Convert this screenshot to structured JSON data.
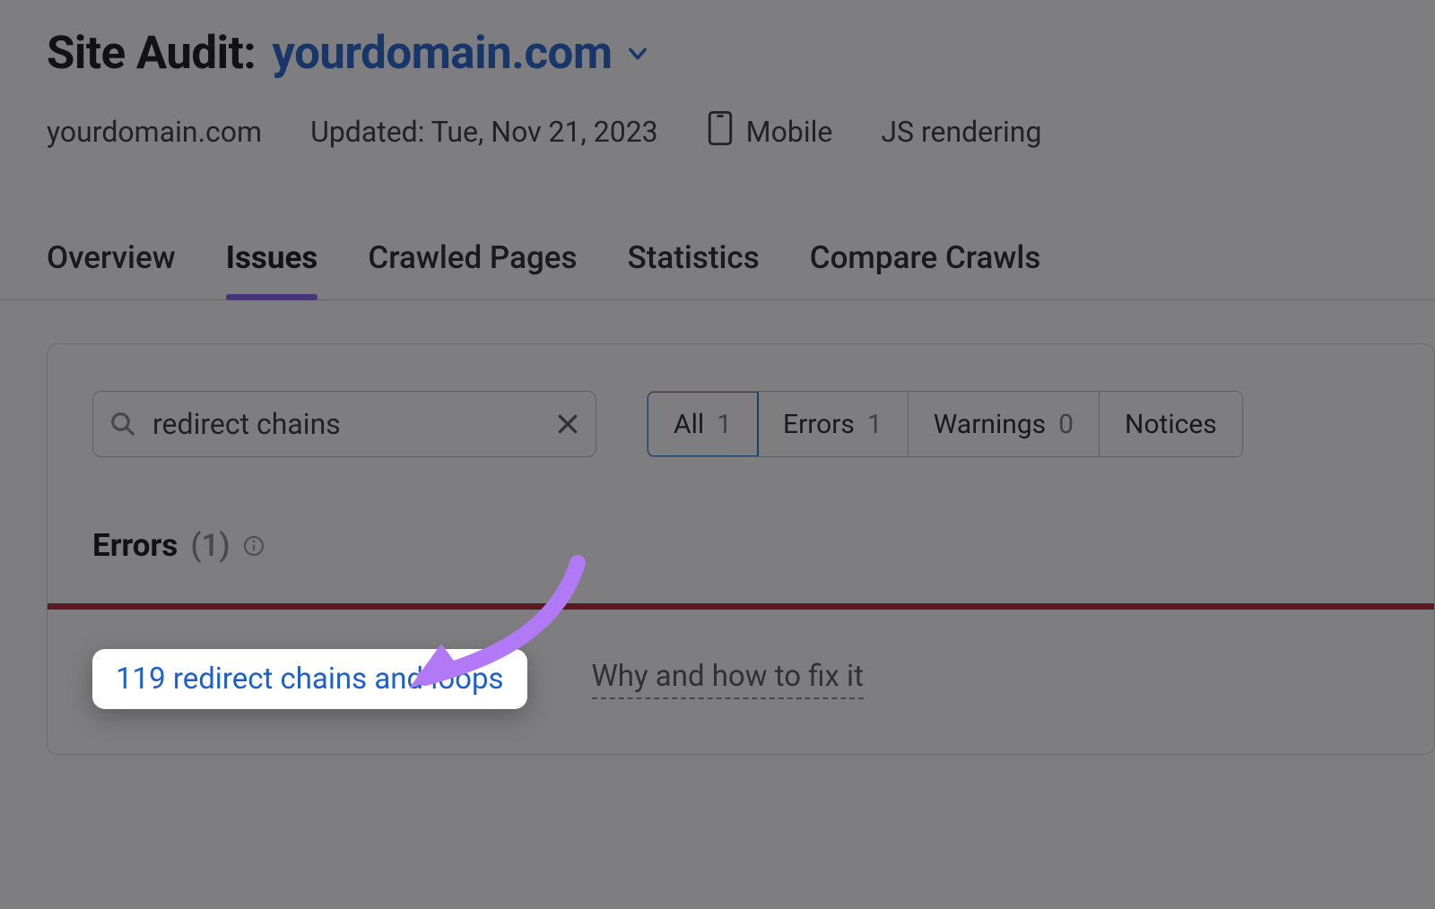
{
  "header": {
    "title_prefix": "Site Audit:",
    "domain": "yourdomain.com"
  },
  "meta": {
    "domain_text": "yourdomain.com",
    "updated": "Updated: Tue, Nov 21, 2023",
    "mobile": "Mobile",
    "js": "JS rendering"
  },
  "tabs": {
    "overview": "Overview",
    "issues": "Issues",
    "crawled": "Crawled Pages",
    "statistics": "Statistics",
    "compare": "Compare Crawls"
  },
  "search": {
    "value": "redirect chains"
  },
  "filters": {
    "all_label": "All",
    "all_count": "1",
    "errors_label": "Errors",
    "errors_count": "1",
    "warnings_label": "Warnings",
    "warnings_count": "0",
    "notices_label": "Notices"
  },
  "errors_section": {
    "label": "Errors",
    "count": "(1)"
  },
  "result": {
    "link": "119 redirect chains and loops",
    "fix": "Why and how to fix it"
  }
}
